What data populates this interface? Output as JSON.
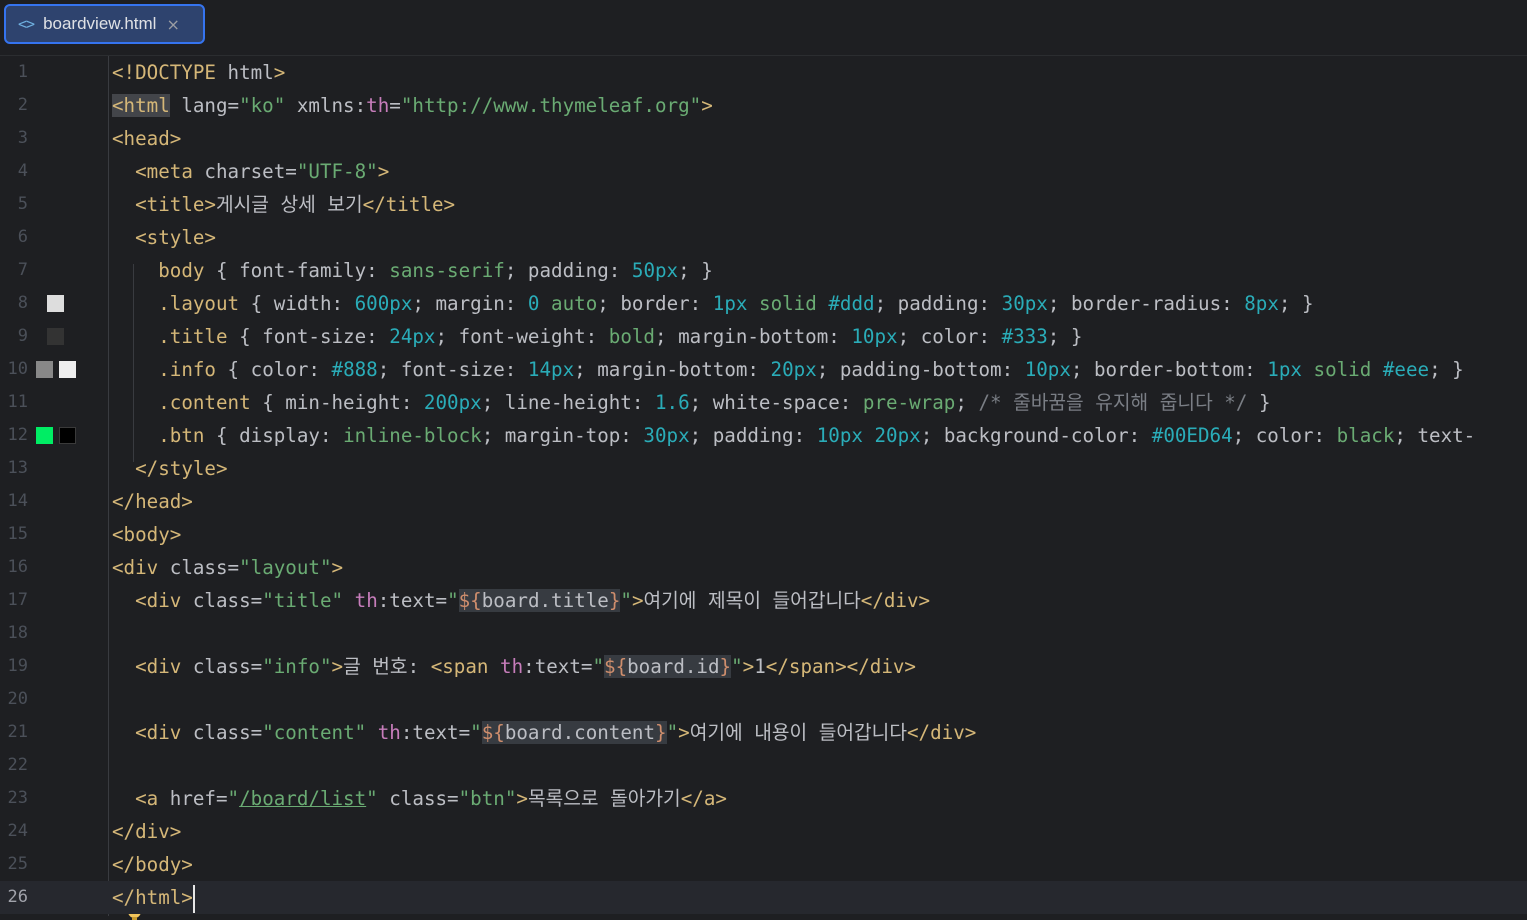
{
  "tab": {
    "filename": "boardview.html",
    "icon": "html-file-icon",
    "icon_glyph": "<>",
    "close_glyph": "×"
  },
  "editor": {
    "current_line": 26,
    "swatches": {
      "line8": [
        "#dddddd"
      ],
      "line9": [
        "#333333"
      ],
      "line10": [
        "#888888",
        "#eeeeee"
      ],
      "line12": [
        "#00ED64",
        "#000000"
      ]
    },
    "lines": [
      {
        "n": "1"
      },
      {
        "n": "2"
      },
      {
        "n": "3"
      },
      {
        "n": "4"
      },
      {
        "n": "5"
      },
      {
        "n": "6"
      },
      {
        "n": "7"
      },
      {
        "n": "8"
      },
      {
        "n": "9"
      },
      {
        "n": "10"
      },
      {
        "n": "11"
      },
      {
        "n": "12"
      },
      {
        "n": "13"
      },
      {
        "n": "14"
      },
      {
        "n": "15"
      },
      {
        "n": "16"
      },
      {
        "n": "17"
      },
      {
        "n": "18"
      },
      {
        "n": "19"
      },
      {
        "n": "20"
      },
      {
        "n": "21"
      },
      {
        "n": "22"
      },
      {
        "n": "23"
      },
      {
        "n": "24"
      },
      {
        "n": "25"
      },
      {
        "n": "26"
      }
    ],
    "code": {
      "l1": [
        [
          "t",
          "<!DOCTYPE "
        ],
        [
          "a",
          "html"
        ],
        [
          "t",
          ">"
        ]
      ],
      "l2": [
        [
          "tagbox",
          "<html"
        ],
        [
          "a",
          " lang="
        ],
        [
          "s",
          "\"ko\""
        ],
        [
          "a",
          " xmlns:"
        ],
        [
          "k",
          "th"
        ],
        [
          "a",
          "="
        ],
        [
          "s",
          "\"http://www.thymeleaf.org\""
        ],
        [
          "t",
          ">"
        ]
      ],
      "l3": [
        [
          "t",
          "<head>"
        ]
      ],
      "l4": [
        [
          "p",
          "  "
        ],
        [
          "t",
          "<meta"
        ],
        [
          "a",
          " charset="
        ],
        [
          "s",
          "\"UTF-8\""
        ],
        [
          "t",
          ">"
        ]
      ],
      "l5": [
        [
          "p",
          "  "
        ],
        [
          "t",
          "<title>"
        ],
        [
          "p",
          "게시글 상세 보기"
        ],
        [
          "t",
          "</title>"
        ]
      ],
      "l6": [
        [
          "p",
          "  "
        ],
        [
          "t",
          "<style>"
        ]
      ],
      "l7": [
        [
          "p",
          "    "
        ],
        [
          "t",
          "body"
        ],
        [
          "p",
          " { font-family: "
        ],
        [
          "s",
          "sans-serif"
        ],
        [
          "p",
          "; padding: "
        ],
        [
          "n",
          "50px"
        ],
        [
          "p",
          "; }"
        ]
      ],
      "l8": [
        [
          "p",
          "    "
        ],
        [
          "t",
          ".layout"
        ],
        [
          "p",
          " { width: "
        ],
        [
          "n",
          "600px"
        ],
        [
          "p",
          "; margin: "
        ],
        [
          "n",
          "0"
        ],
        [
          "p",
          " "
        ],
        [
          "s",
          "auto"
        ],
        [
          "p",
          "; border: "
        ],
        [
          "n",
          "1px"
        ],
        [
          "p",
          " "
        ],
        [
          "s",
          "solid"
        ],
        [
          "p",
          " "
        ],
        [
          "n",
          "#ddd"
        ],
        [
          "p",
          "; padding: "
        ],
        [
          "n",
          "30px"
        ],
        [
          "p",
          "; border-radius: "
        ],
        [
          "n",
          "8px"
        ],
        [
          "p",
          "; }"
        ]
      ],
      "l9": [
        [
          "p",
          "    "
        ],
        [
          "t",
          ".title"
        ],
        [
          "p",
          " { font-size: "
        ],
        [
          "n",
          "24px"
        ],
        [
          "p",
          "; font-weight: "
        ],
        [
          "s",
          "bold"
        ],
        [
          "p",
          "; margin-bottom: "
        ],
        [
          "n",
          "10px"
        ],
        [
          "p",
          "; color: "
        ],
        [
          "n",
          "#333"
        ],
        [
          "p",
          "; }"
        ]
      ],
      "l10": [
        [
          "p",
          "    "
        ],
        [
          "t",
          ".info"
        ],
        [
          "p",
          " { color: "
        ],
        [
          "n",
          "#888"
        ],
        [
          "p",
          "; font-size: "
        ],
        [
          "n",
          "14px"
        ],
        [
          "p",
          "; margin-bottom: "
        ],
        [
          "n",
          "20px"
        ],
        [
          "p",
          "; padding-bottom: "
        ],
        [
          "n",
          "10px"
        ],
        [
          "p",
          "; border-bottom: "
        ],
        [
          "n",
          "1px"
        ],
        [
          "p",
          " "
        ],
        [
          "s",
          "solid"
        ],
        [
          "p",
          " "
        ],
        [
          "n",
          "#eee"
        ],
        [
          "p",
          "; }"
        ]
      ],
      "l11": [
        [
          "p",
          "    "
        ],
        [
          "t",
          ".content"
        ],
        [
          "p",
          " { min-height: "
        ],
        [
          "n",
          "200px"
        ],
        [
          "p",
          "; line-height: "
        ],
        [
          "n",
          "1.6"
        ],
        [
          "p",
          "; white-space: "
        ],
        [
          "s",
          "pre-wrap"
        ],
        [
          "p",
          "; "
        ],
        [
          "c",
          "/* 줄바꿈을 유지해 줍니다 */"
        ],
        [
          "p",
          " }"
        ]
      ],
      "l12": [
        [
          "p",
          "    "
        ],
        [
          "t",
          ".btn"
        ],
        [
          "p",
          " { display: "
        ],
        [
          "s",
          "inline-block"
        ],
        [
          "p",
          "; margin-top: "
        ],
        [
          "n",
          "30px"
        ],
        [
          "p",
          "; padding: "
        ],
        [
          "n",
          "10px"
        ],
        [
          "p",
          " "
        ],
        [
          "n",
          "20px"
        ],
        [
          "p",
          "; background-color: "
        ],
        [
          "n",
          "#00ED64"
        ],
        [
          "p",
          "; color: "
        ],
        [
          "s",
          "black"
        ],
        [
          "p",
          "; text-"
        ]
      ],
      "l13": [
        [
          "p",
          "  "
        ],
        [
          "t",
          "</style>"
        ]
      ],
      "l14": [
        [
          "t",
          "</head>"
        ]
      ],
      "l15": [
        [
          "t",
          "<body>"
        ]
      ],
      "l16": [
        [
          "t",
          "<div"
        ],
        [
          "a",
          " class="
        ],
        [
          "s",
          "\"layout\""
        ],
        [
          "t",
          ">"
        ]
      ],
      "l17": [
        [
          "p",
          "  "
        ],
        [
          "t",
          "<div"
        ],
        [
          "a",
          " class="
        ],
        [
          "s",
          "\"title\""
        ],
        [
          "a",
          " "
        ],
        [
          "k",
          "th"
        ],
        [
          "a",
          ":text="
        ],
        [
          "s",
          "\""
        ],
        [
          "hl_e",
          "${"
        ],
        [
          "hl",
          "board.title"
        ],
        [
          "hl_e",
          "}"
        ],
        [
          "s",
          "\""
        ],
        [
          "t",
          ">"
        ],
        [
          "p",
          "여기에 제목이 들어갑니다"
        ],
        [
          "t",
          "</div>"
        ]
      ],
      "l18": [],
      "l19": [
        [
          "p",
          "  "
        ],
        [
          "t",
          "<div"
        ],
        [
          "a",
          " class="
        ],
        [
          "s",
          "\"info\""
        ],
        [
          "t",
          ">"
        ],
        [
          "p",
          "글 번호: "
        ],
        [
          "t",
          "<span"
        ],
        [
          "a",
          " "
        ],
        [
          "k",
          "th"
        ],
        [
          "a",
          ":text="
        ],
        [
          "s",
          "\""
        ],
        [
          "hl_e",
          "${"
        ],
        [
          "hl",
          "board.id"
        ],
        [
          "hl_e",
          "}"
        ],
        [
          "s",
          "\""
        ],
        [
          "t",
          ">"
        ],
        [
          "p",
          "1"
        ],
        [
          "t",
          "</span></div>"
        ]
      ],
      "l20": [],
      "l21": [
        [
          "p",
          "  "
        ],
        [
          "t",
          "<div"
        ],
        [
          "a",
          " class="
        ],
        [
          "s",
          "\"content\""
        ],
        [
          "a",
          " "
        ],
        [
          "k",
          "th"
        ],
        [
          "a",
          ":text="
        ],
        [
          "s",
          "\""
        ],
        [
          "hl_e",
          "${"
        ],
        [
          "hl",
          "board.content"
        ],
        [
          "hl_e",
          "}"
        ],
        [
          "s",
          "\""
        ],
        [
          "t",
          ">"
        ],
        [
          "p",
          "여기에 내용이 들어갑니다"
        ],
        [
          "t",
          "</div>"
        ]
      ],
      "l22": [],
      "l23": [
        [
          "p",
          "  "
        ],
        [
          "t",
          "<a"
        ],
        [
          "a",
          " href="
        ],
        [
          "s",
          "\""
        ],
        [
          "link",
          "/board/list"
        ],
        [
          "s",
          "\""
        ],
        [
          "a",
          " class="
        ],
        [
          "s",
          "\"btn\""
        ],
        [
          "t",
          ">"
        ],
        [
          "p",
          "목록으로 돌아가기"
        ],
        [
          "t",
          "</a>"
        ]
      ],
      "l24": [
        [
          "t",
          "</div>"
        ]
      ],
      "l25": [
        [
          "t",
          "</body>"
        ]
      ],
      "l26": [
        [
          "t",
          "</html>"
        ]
      ]
    }
  }
}
